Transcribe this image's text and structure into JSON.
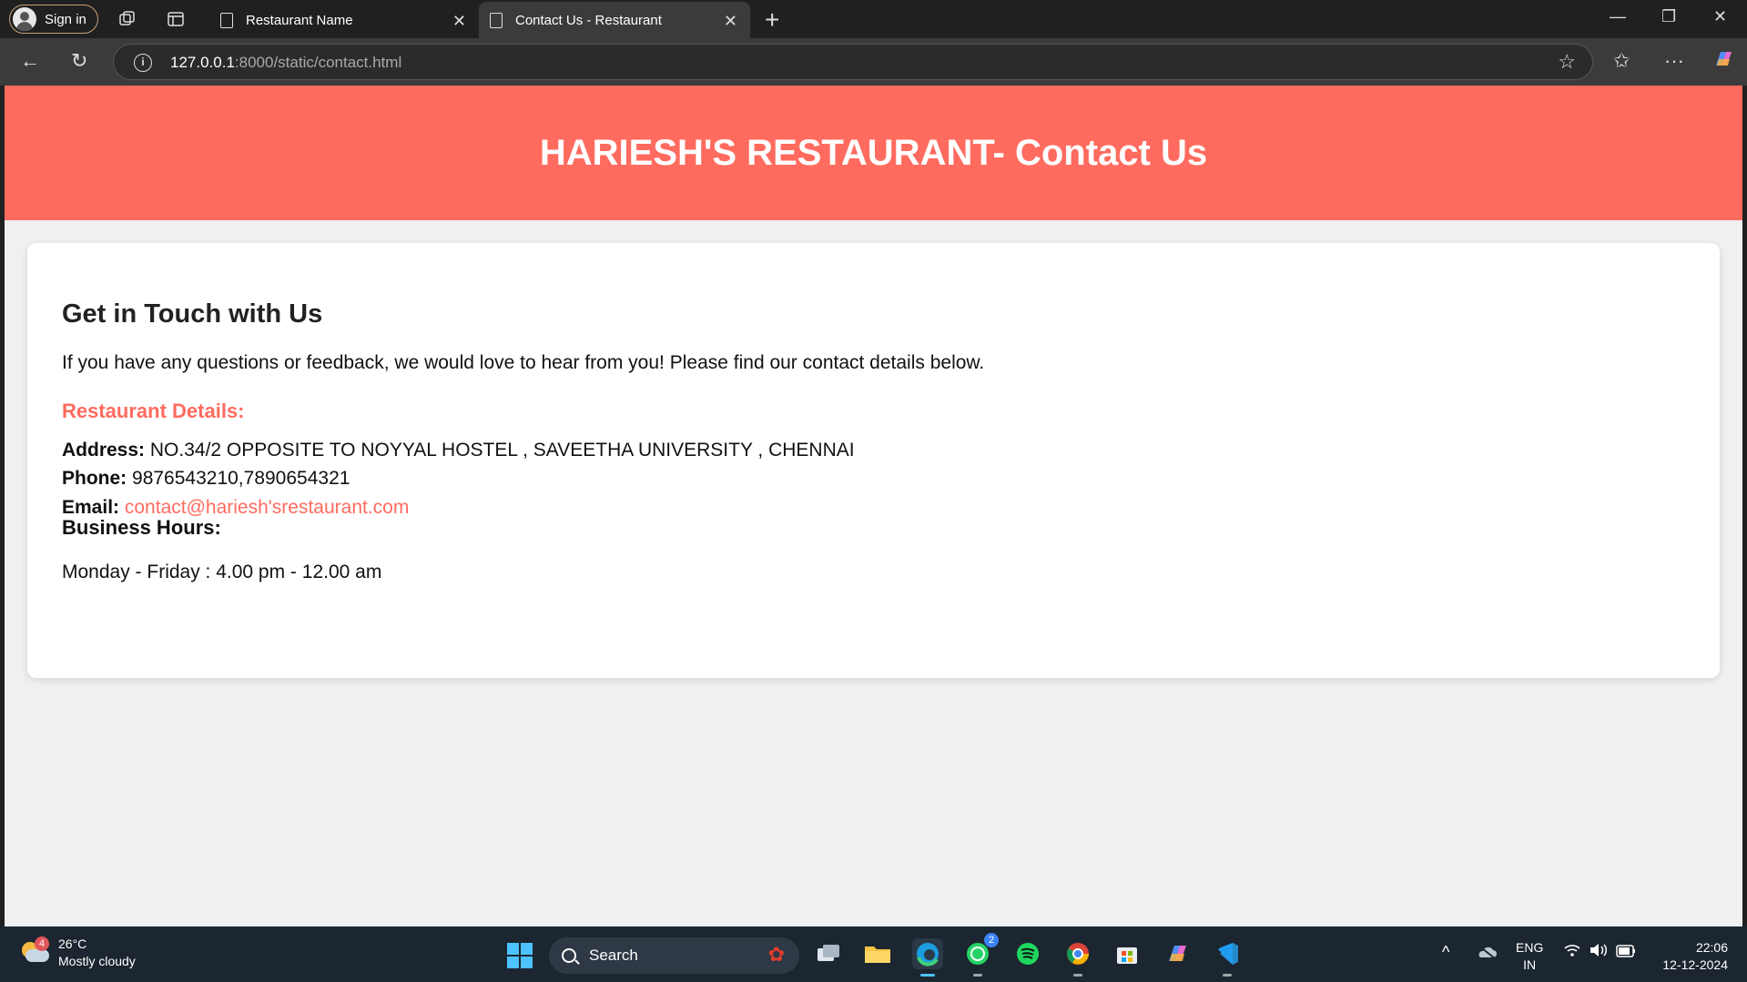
{
  "browser": {
    "signin_label": "Sign in",
    "tabs": [
      {
        "label": "Restaurant Name"
      },
      {
        "label": "Contact Us - Restaurant"
      }
    ],
    "url_host": "127.0.0.1",
    "url_rest": ":8000/static/contact.html"
  },
  "page": {
    "header_title": "HARIESH'S RESTAURANT- Contact Us",
    "heading": "Get in Touch with Us",
    "intro": "If you have any questions or feedback, we would love to hear from you! Please find our contact details below.",
    "details_heading": "Restaurant Details:",
    "address_label": "Address:",
    "address_value": "NO.34/2 OPPOSITE TO NOYYAL HOSTEL , SAVEETHA UNIVERSITY , CHENNAI",
    "phone_label": "Phone:",
    "phone_value": "9876543210,7890654321",
    "email_label": "Email:",
    "email_value": "contact@hariesh'srestaurant.com",
    "hours_heading": "Business Hours:",
    "hours_value": "Monday - Friday : 4.00 pm - 12.00 am",
    "accent_color": "#ff6b5f"
  },
  "taskbar": {
    "weather_temp": "26°C",
    "weather_desc": "Mostly cloudy",
    "weather_badge": "4",
    "search_label": "Search",
    "whatsapp_badge": "2",
    "lang_line1": "ENG",
    "lang_line2": "IN",
    "time": "22:06",
    "date": "12-12-2024"
  }
}
